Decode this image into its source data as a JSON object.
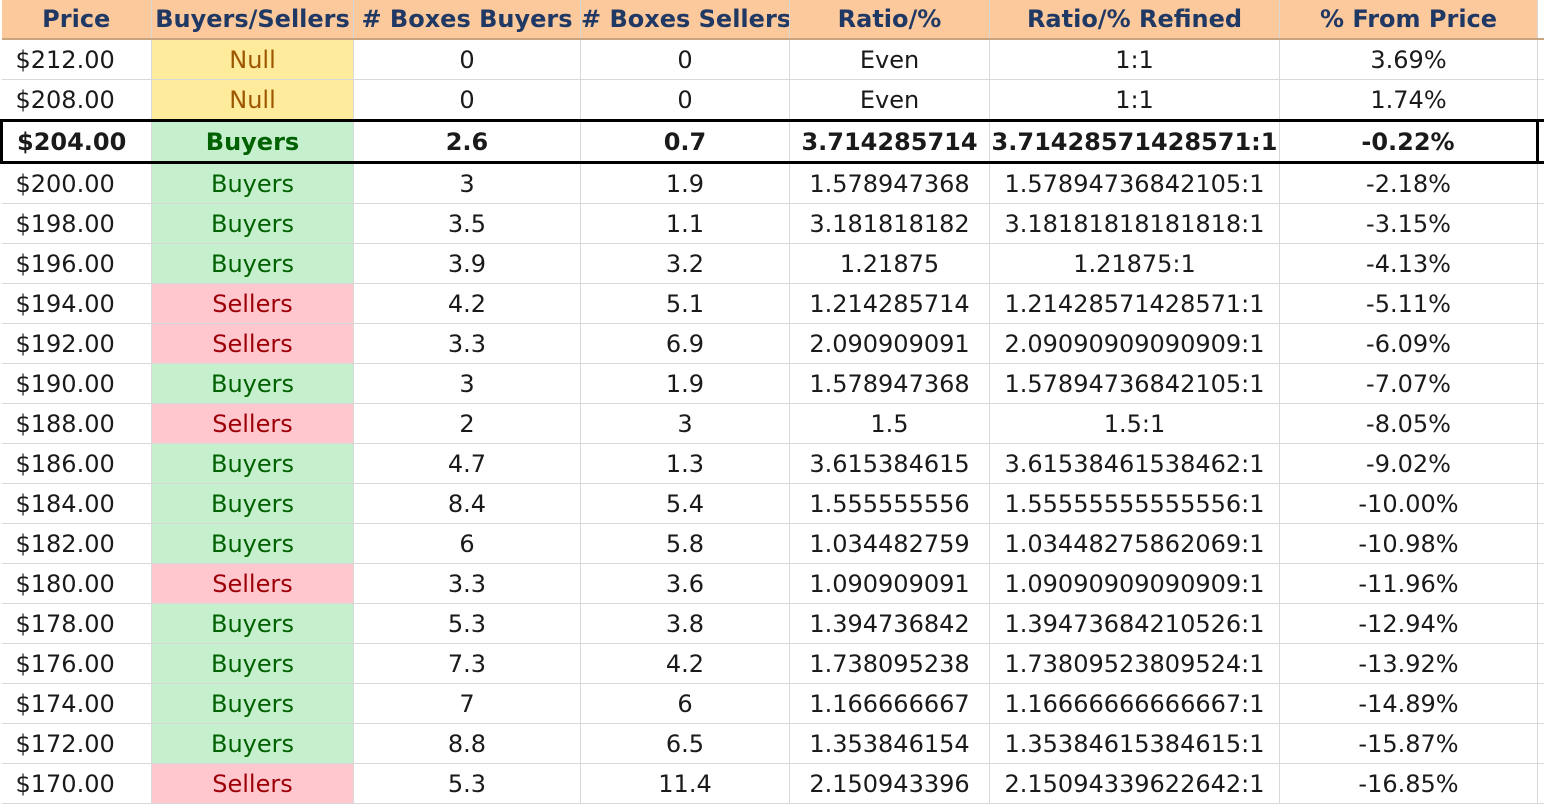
{
  "columns": [
    "Price",
    "Buyers/Sellers",
    "# Boxes Buyers",
    "# Boxes Sellers",
    "Ratio/%",
    "Ratio/% Refined",
    "% From Price"
  ],
  "colors": {
    "header_bg": "#fcc99c",
    "header_text": "#203864",
    "null_bg": "#ffeb9c",
    "null_text": "#9c5700",
    "buyers_bg": "#c6efce",
    "buyers_text": "#006100",
    "sellers_bg": "#ffc7ce",
    "sellers_text": "#9c0006"
  },
  "current_row_index": 2,
  "rows": [
    {
      "price": "$212.00",
      "side": "Null",
      "boxes_buyers": "0",
      "boxes_sellers": "0",
      "ratio": "Even",
      "ratio_refined": "1:1",
      "pct_from_price": "3.69%"
    },
    {
      "price": "$208.00",
      "side": "Null",
      "boxes_buyers": "0",
      "boxes_sellers": "0",
      "ratio": "Even",
      "ratio_refined": "1:1",
      "pct_from_price": "1.74%"
    },
    {
      "price": "$204.00",
      "side": "Buyers",
      "boxes_buyers": "2.6",
      "boxes_sellers": "0.7",
      "ratio": "3.714285714",
      "ratio_refined": "3.71428571428571:1",
      "pct_from_price": "-0.22%"
    },
    {
      "price": "$200.00",
      "side": "Buyers",
      "boxes_buyers": "3",
      "boxes_sellers": "1.9",
      "ratio": "1.578947368",
      "ratio_refined": "1.57894736842105:1",
      "pct_from_price": "-2.18%"
    },
    {
      "price": "$198.00",
      "side": "Buyers",
      "boxes_buyers": "3.5",
      "boxes_sellers": "1.1",
      "ratio": "3.181818182",
      "ratio_refined": "3.18181818181818:1",
      "pct_from_price": "-3.15%"
    },
    {
      "price": "$196.00",
      "side": "Buyers",
      "boxes_buyers": "3.9",
      "boxes_sellers": "3.2",
      "ratio": "1.21875",
      "ratio_refined": "1.21875:1",
      "pct_from_price": "-4.13%"
    },
    {
      "price": "$194.00",
      "side": "Sellers",
      "boxes_buyers": "4.2",
      "boxes_sellers": "5.1",
      "ratio": "1.214285714",
      "ratio_refined": "1.21428571428571:1",
      "pct_from_price": "-5.11%"
    },
    {
      "price": "$192.00",
      "side": "Sellers",
      "boxes_buyers": "3.3",
      "boxes_sellers": "6.9",
      "ratio": "2.090909091",
      "ratio_refined": "2.09090909090909:1",
      "pct_from_price": "-6.09%"
    },
    {
      "price": "$190.00",
      "side": "Buyers",
      "boxes_buyers": "3",
      "boxes_sellers": "1.9",
      "ratio": "1.578947368",
      "ratio_refined": "1.57894736842105:1",
      "pct_from_price": "-7.07%"
    },
    {
      "price": "$188.00",
      "side": "Sellers",
      "boxes_buyers": "2",
      "boxes_sellers": "3",
      "ratio": "1.5",
      "ratio_refined": "1.5:1",
      "pct_from_price": "-8.05%"
    },
    {
      "price": "$186.00",
      "side": "Buyers",
      "boxes_buyers": "4.7",
      "boxes_sellers": "1.3",
      "ratio": "3.615384615",
      "ratio_refined": "3.61538461538462:1",
      "pct_from_price": "-9.02%"
    },
    {
      "price": "$184.00",
      "side": "Buyers",
      "boxes_buyers": "8.4",
      "boxes_sellers": "5.4",
      "ratio": "1.555555556",
      "ratio_refined": "1.55555555555556:1",
      "pct_from_price": "-10.00%"
    },
    {
      "price": "$182.00",
      "side": "Buyers",
      "boxes_buyers": "6",
      "boxes_sellers": "5.8",
      "ratio": "1.034482759",
      "ratio_refined": "1.03448275862069:1",
      "pct_from_price": "-10.98%"
    },
    {
      "price": "$180.00",
      "side": "Sellers",
      "boxes_buyers": "3.3",
      "boxes_sellers": "3.6",
      "ratio": "1.090909091",
      "ratio_refined": "1.09090909090909:1",
      "pct_from_price": "-11.96%"
    },
    {
      "price": "$178.00",
      "side": "Buyers",
      "boxes_buyers": "5.3",
      "boxes_sellers": "3.8",
      "ratio": "1.394736842",
      "ratio_refined": "1.39473684210526:1",
      "pct_from_price": "-12.94%"
    },
    {
      "price": "$176.00",
      "side": "Buyers",
      "boxes_buyers": "7.3",
      "boxes_sellers": "4.2",
      "ratio": "1.738095238",
      "ratio_refined": "1.73809523809524:1",
      "pct_from_price": "-13.92%"
    },
    {
      "price": "$174.00",
      "side": "Buyers",
      "boxes_buyers": "7",
      "boxes_sellers": "6",
      "ratio": "1.166666667",
      "ratio_refined": "1.16666666666667:1",
      "pct_from_price": "-14.89%"
    },
    {
      "price": "$172.00",
      "side": "Buyers",
      "boxes_buyers": "8.8",
      "boxes_sellers": "6.5",
      "ratio": "1.353846154",
      "ratio_refined": "1.35384615384615:1",
      "pct_from_price": "-15.87%"
    },
    {
      "price": "$170.00",
      "side": "Sellers",
      "boxes_buyers": "5.3",
      "boxes_sellers": "11.4",
      "ratio": "2.150943396",
      "ratio_refined": "2.15094339622642:1",
      "pct_from_price": "-16.85%"
    }
  ]
}
